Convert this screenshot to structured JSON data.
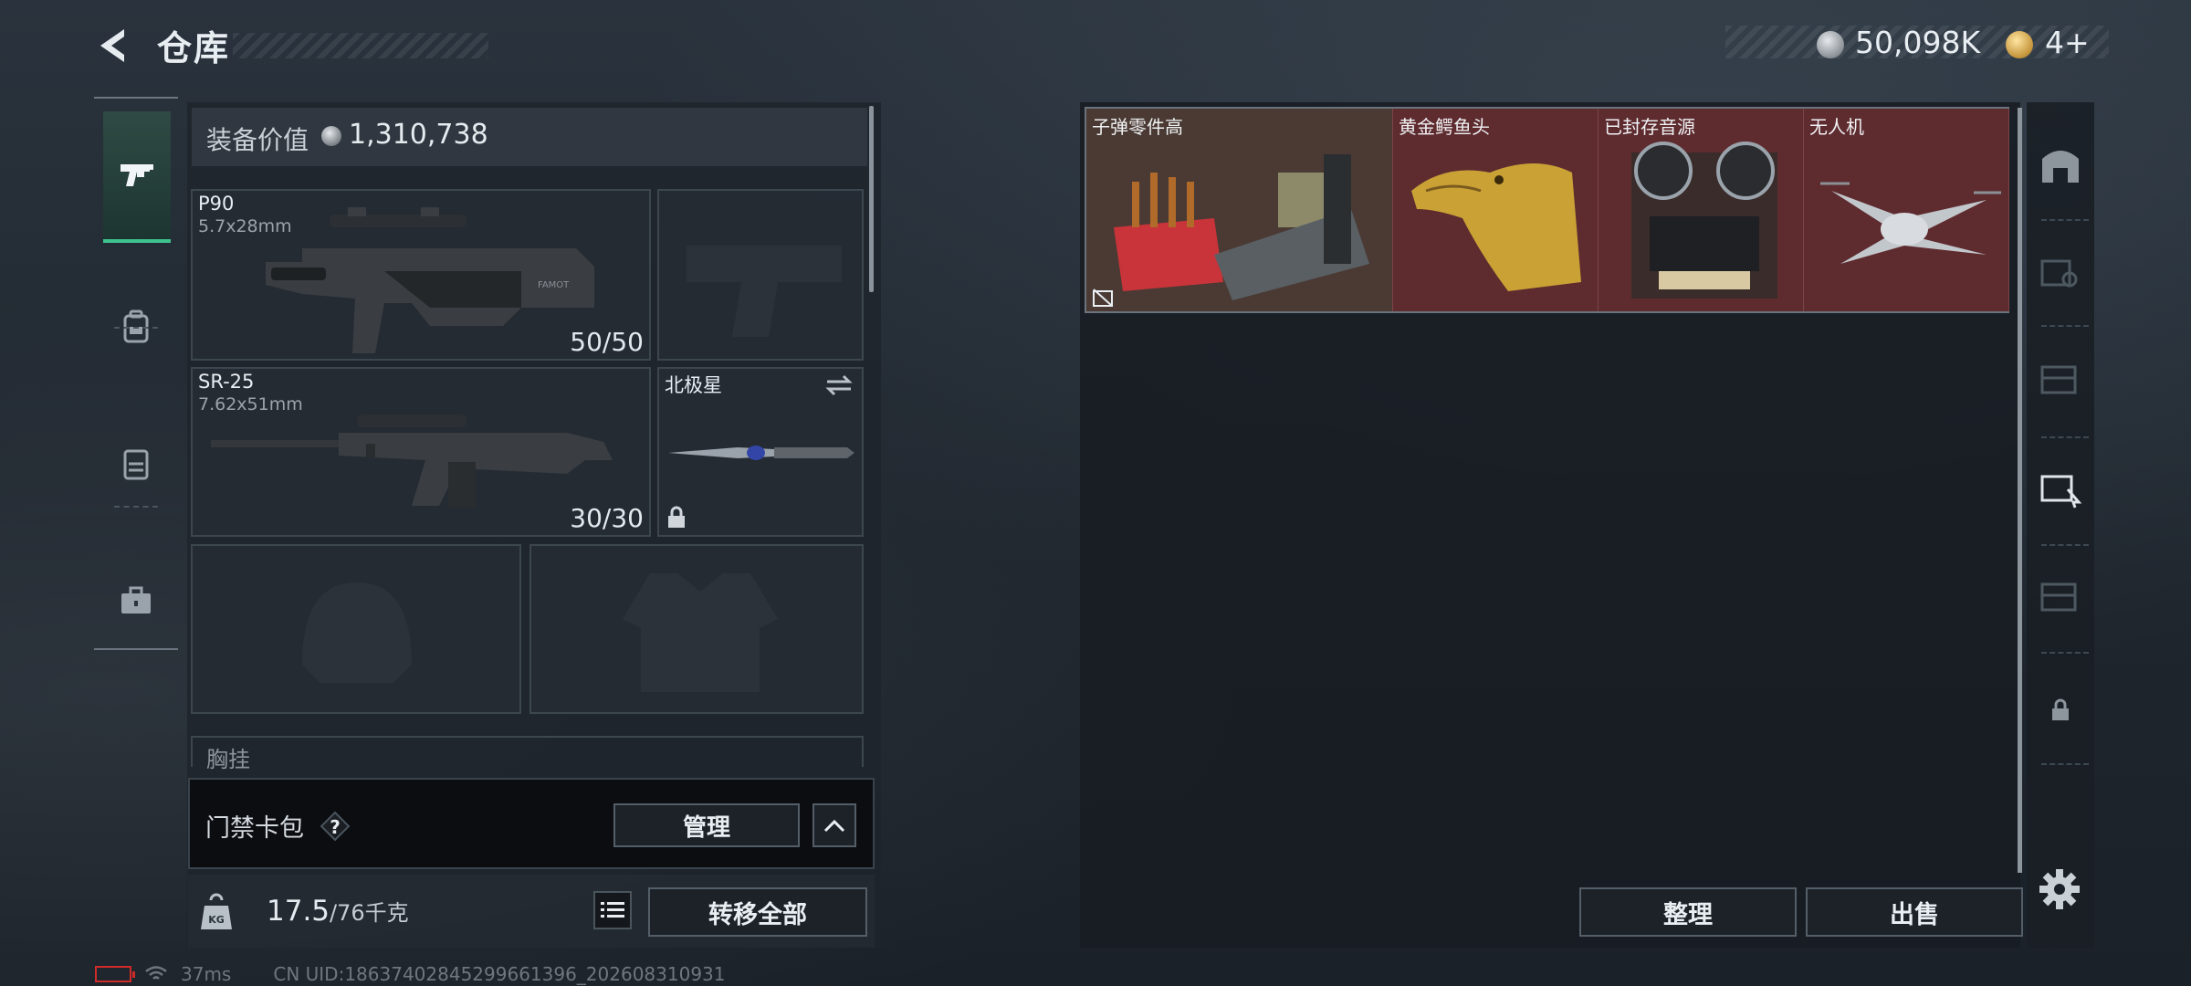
{
  "header": {
    "title": "仓库",
    "currency_main": "50,098K",
    "currency_secondary": "4+",
    "colors": {
      "accent_green": "#3ec38f",
      "item_red": "#5e2b2f",
      "battery_red": "#d02b2b"
    }
  },
  "equipment": {
    "value_label": "装备价值",
    "value": "1,310,738",
    "primary": {
      "name": "P90",
      "caliber": "5.7x28mm",
      "ammo": "50/50"
    },
    "secondary": {
      "name": "SR-25",
      "caliber": "7.62x51mm",
      "ammo": "30/30"
    },
    "melee": {
      "name": "北极星"
    },
    "chest_label": "胸挂"
  },
  "keycard": {
    "label": "门禁卡包",
    "help": "?",
    "manage_label": "管理"
  },
  "capacity": {
    "current": "17.5",
    "max": "/76千克",
    "transfer_label": "转移全部"
  },
  "status": {
    "ping": "37ms",
    "uid": "CN UID:18637402845299661396_202608310931"
  },
  "storage": {
    "items": [
      {
        "name": "子弹零件高"
      },
      {
        "name": "黄金鳄鱼头"
      },
      {
        "name": "已封存音源"
      },
      {
        "name": "无人机"
      }
    ],
    "sort_label": "整理",
    "sell_label": "出售"
  }
}
